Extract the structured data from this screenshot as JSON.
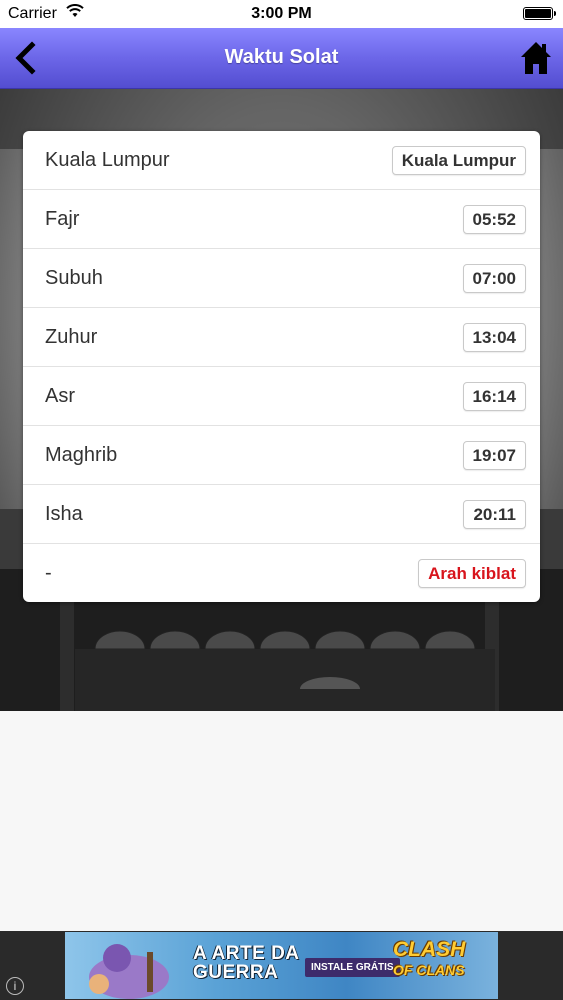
{
  "status_bar": {
    "carrier": "Carrier",
    "time": "3:00 PM"
  },
  "nav": {
    "title": "Waktu Solat",
    "back_icon": "chevron-left-icon",
    "home_icon": "home-icon",
    "background_color": "#6c66e8"
  },
  "location": {
    "label": "Kuala Lumpur",
    "button": "Kuala Lumpur"
  },
  "prayers": [
    {
      "name": "Fajr",
      "time": "05:52"
    },
    {
      "name": "Subuh",
      "time": "07:00"
    },
    {
      "name": "Zuhur",
      "time": "13:04"
    },
    {
      "name": "Asr",
      "time": "16:14"
    },
    {
      "name": "Maghrib",
      "time": "19:07"
    },
    {
      "name": "Isha",
      "time": "20:11"
    }
  ],
  "qibla": {
    "label": "-",
    "button": "Arah kiblat",
    "button_color": "#d8141c"
  },
  "ad": {
    "headline_1": "A ARTE DA",
    "headline_2": "GUERRA",
    "cta": "INSTALE GRÁTIS",
    "logo_1": "CLASH",
    "logo_2": "OF CLANS",
    "info_icon": "info-icon",
    "info_glyph": "i"
  }
}
